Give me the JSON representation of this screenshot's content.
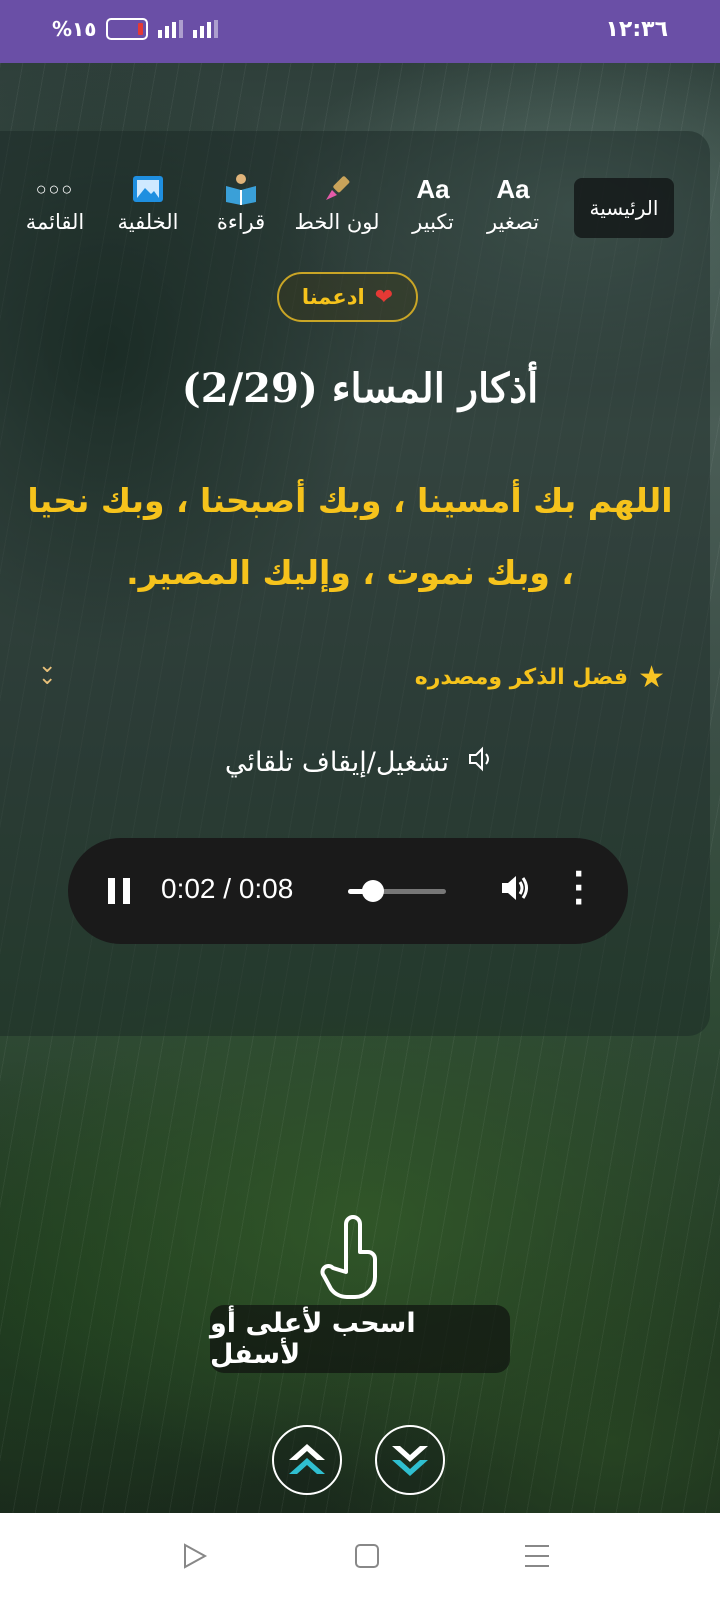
{
  "status_bar": {
    "time": "١٢:٣٦",
    "battery": "%١٥"
  },
  "toolbar": {
    "home": "الرئيسية",
    "items": [
      {
        "icon": "Aa",
        "label": "تصغير"
      },
      {
        "icon": "Aa",
        "label": "تكبير"
      },
      {
        "icon": "paintbrush-icon",
        "label": "لون الخط"
      },
      {
        "icon": "book-reader-icon",
        "label": "قراءة"
      },
      {
        "icon": "picture-icon",
        "label": "الخلفية"
      },
      {
        "icon": "dots-icon",
        "label": "القائمة"
      }
    ]
  },
  "support_label": "ادعمنا",
  "title": "أذكار المساء (2/29)",
  "zikr_text": "اللهم بك أمسينا ، وبك أصبحنا ، وبك نحيا ، وبك نموت ، وإليك المصير.",
  "virtue_label": "فضل الذكر ومصدره",
  "autoplay_label": "تشغيل/إيقاف تلقائي",
  "player": {
    "time": "0:02 / 0:08",
    "progress": 0.25
  },
  "swipe_hint": "اسحب لأعلى أو لأسفل",
  "colors": {
    "status_bar": "#6a4fa6",
    "accent_yellow": "#f6c31c"
  }
}
